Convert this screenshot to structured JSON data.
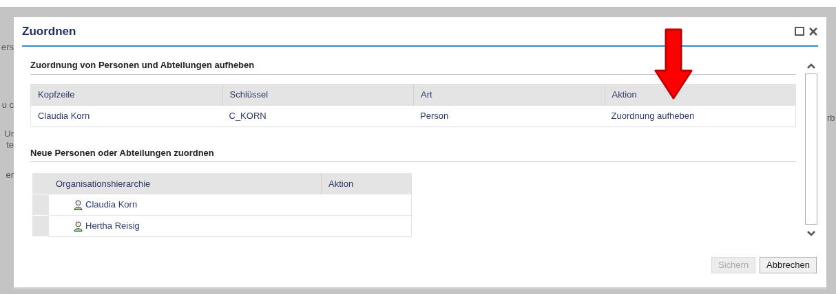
{
  "background": {
    "left_fragments": [
      "ers",
      "u c",
      "Ur",
      "te",
      "er"
    ],
    "right_fragment": "rb"
  },
  "dialog": {
    "title": "Zuordnen",
    "remove_section": {
      "heading": "Zuordnung von Personen und Abteilungen aufheben",
      "columns": [
        "Kopfzeile",
        "Schlüssel",
        "Art",
        "Aktion"
      ],
      "rows": [
        [
          "Claudia Korn",
          "C_KORN",
          "Person",
          "Zuordnung aufheben"
        ]
      ]
    },
    "add_section": {
      "heading": "Neue Personen oder Abteilungen zuordnen",
      "columns": [
        "Organisationshierarchie",
        "Aktion"
      ],
      "rows": [
        {
          "name": "Claudia Korn",
          "kind": "person"
        },
        {
          "name": "Hertha Reisig",
          "kind": "person"
        }
      ]
    },
    "buttons": [
      {
        "label": "Sichern",
        "disabled": true
      },
      {
        "label": "Abbrechen",
        "disabled": false
      }
    ]
  }
}
